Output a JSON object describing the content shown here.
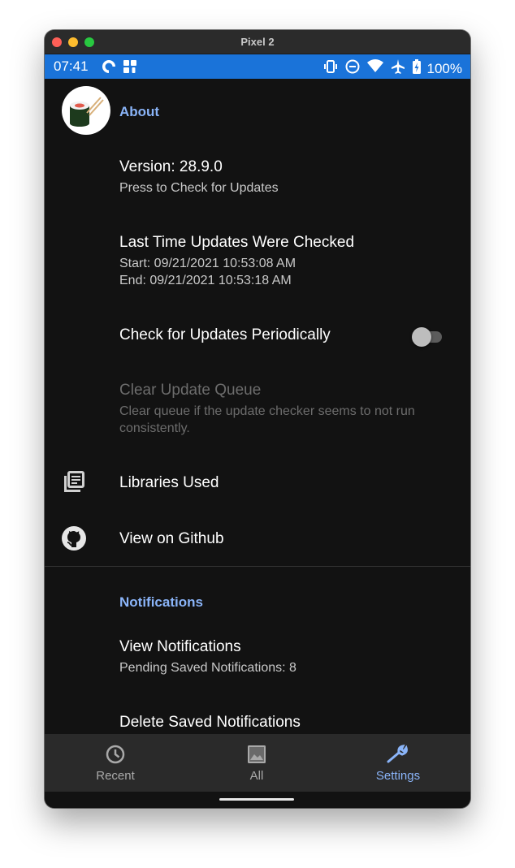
{
  "window": {
    "title": "Pixel 2"
  },
  "status_bar": {
    "time": "07:41",
    "battery": "100%",
    "left_icons": [
      "pocket-casts-icon",
      "app-grid-icon"
    ],
    "right_icons": [
      "vibrate-icon",
      "do-not-disturb-icon",
      "wifi-icon",
      "airplane-icon",
      "battery-charging-icon"
    ],
    "color": "#1a73d9"
  },
  "about": {
    "header": "About",
    "version_title": "Version: 28.9.0",
    "version_summary": "Press to Check for Updates",
    "last_check_title": "Last Time Updates Were Checked",
    "last_check_start": "Start: 09/21/2021 10:53:08 AM",
    "last_check_end": "End: 09/21/2021 10:53:18 AM",
    "periodic_title": "Check for Updates Periodically",
    "periodic_enabled": false,
    "clear_queue_title": "Clear Update Queue",
    "clear_queue_summary": "Clear queue if the update checker seems to not run consistently.",
    "libraries_title": "Libraries Used",
    "github_title": "View on Github"
  },
  "notifications": {
    "header": "Notifications",
    "view_title": "View Notifications",
    "view_summary": "Pending Saved Notifications: 8",
    "delete_title": "Delete Saved Notifications"
  },
  "bottom_nav": {
    "items": [
      {
        "label": "Recent",
        "icon": "clock-icon",
        "active": false
      },
      {
        "label": "All",
        "icon": "image-icon",
        "active": false
      },
      {
        "label": "Settings",
        "icon": "wrench-icon",
        "active": true
      }
    ]
  },
  "colors": {
    "accent": "#8ab4f8",
    "background": "#121212",
    "nav_background": "#2a2a2a"
  }
}
